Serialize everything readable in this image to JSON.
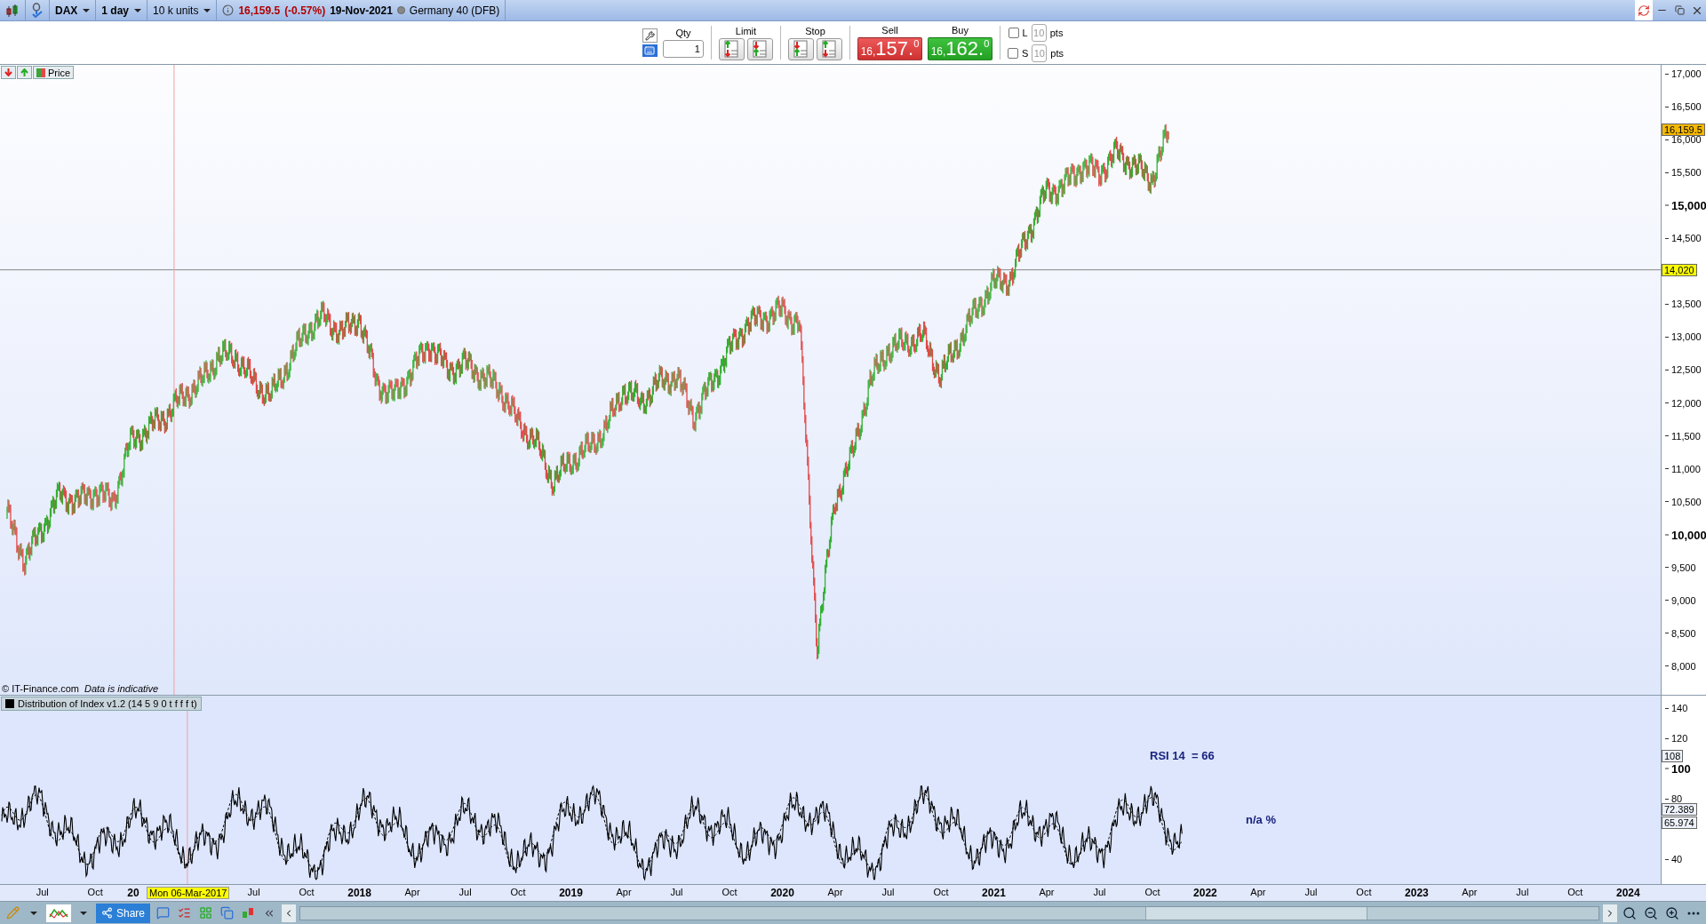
{
  "toolbar": {
    "symbol": "DAX",
    "interval": "1 day",
    "size": "10 k units",
    "price": "16,159.5",
    "change": "(-0.57%)",
    "date": "19-Nov-2021",
    "market": "Germany 40 (DFB)"
  },
  "ticket": {
    "qty_label": "Qty",
    "qty": "1",
    "limit_label": "Limit",
    "stop_label": "Stop",
    "sell": {
      "label": "Sell",
      "lead": "16,",
      "main": "157.",
      "tail": "0"
    },
    "buy": {
      "label": "Buy",
      "lead": "16,",
      "main": "162.",
      "tail": "0"
    },
    "stops": [
      {
        "label": "L",
        "value": "10",
        "unit": "pts",
        "checked": false
      },
      {
        "label": "S",
        "value": "10",
        "unit": "pts",
        "checked": false
      }
    ]
  },
  "price_panel": {
    "legend": "Price",
    "copyright": "© IT-Finance.com",
    "disclaimer": "Data is indicative",
    "last_price_tag": "16,159.5",
    "crosshair_price_tag": "14,020",
    "axis_labels": [
      {
        "label": "17,000",
        "kind": "minor"
      },
      {
        "label": "16,500",
        "kind": "minor"
      },
      {
        "label": "16,000",
        "kind": "minor"
      },
      {
        "label": "15,500",
        "kind": "minor"
      },
      {
        "label": "15,000",
        "kind": "major"
      },
      {
        "label": "14,500",
        "kind": "minor"
      },
      {
        "label": "13,500",
        "kind": "minor"
      },
      {
        "label": "13,000",
        "kind": "minor"
      },
      {
        "label": "12,500",
        "kind": "minor"
      },
      {
        "label": "12,000",
        "kind": "minor"
      },
      {
        "label": "11,500",
        "kind": "minor"
      },
      {
        "label": "11,000",
        "kind": "minor"
      },
      {
        "label": "10,500",
        "kind": "minor"
      },
      {
        "label": "10,000",
        "kind": "major"
      },
      {
        "label": "9,500",
        "kind": "minor"
      },
      {
        "label": "9,000",
        "kind": "minor"
      },
      {
        "label": "8,500",
        "kind": "minor"
      },
      {
        "label": "8,000",
        "kind": "minor"
      }
    ]
  },
  "indicator_panel": {
    "legend": "Distribution of Index v1.2 (14 5 9 0 t f f f t)",
    "rsi_text": "RSI 14  = 66",
    "pct_text": "n/a %",
    "axis_labels": [
      {
        "label": "140",
        "kind": "minor"
      },
      {
        "label": "120",
        "kind": "minor"
      },
      {
        "label": "100",
        "kind": "major"
      },
      {
        "label": "80",
        "kind": "minor"
      },
      {
        "label": "40",
        "kind": "minor"
      }
    ],
    "tags": [
      "108",
      "72.389",
      "65.974"
    ]
  },
  "time_axis": {
    "crosshair_date": "Mon 06-Mar-2017",
    "labels": [
      {
        "label": "Jul",
        "kind": "month"
      },
      {
        "label": "Oct",
        "kind": "month"
      },
      {
        "label": "20",
        "kind": "year"
      },
      {
        "label": "Jul",
        "kind": "month",
        "after_hidden": true
      },
      {
        "label": "Oct",
        "kind": "month"
      },
      {
        "label": "2018",
        "kind": "year"
      },
      {
        "label": "Apr",
        "kind": "month"
      },
      {
        "label": "Jul",
        "kind": "month"
      },
      {
        "label": "Oct",
        "kind": "month"
      },
      {
        "label": "2019",
        "kind": "year"
      },
      {
        "label": "Apr",
        "kind": "month"
      },
      {
        "label": "Jul",
        "kind": "month"
      },
      {
        "label": "Oct",
        "kind": "month"
      },
      {
        "label": "2020",
        "kind": "year"
      },
      {
        "label": "Apr",
        "kind": "month"
      },
      {
        "label": "Jul",
        "kind": "month"
      },
      {
        "label": "Oct",
        "kind": "month"
      },
      {
        "label": "2021",
        "kind": "year"
      },
      {
        "label": "Apr",
        "kind": "month"
      },
      {
        "label": "Jul",
        "kind": "month"
      },
      {
        "label": "Oct",
        "kind": "month"
      },
      {
        "label": "2022",
        "kind": "year"
      },
      {
        "label": "Apr",
        "kind": "month"
      },
      {
        "label": "Jul",
        "kind": "month"
      },
      {
        "label": "Oct",
        "kind": "month"
      },
      {
        "label": "2023",
        "kind": "year"
      },
      {
        "label": "Apr",
        "kind": "month"
      },
      {
        "label": "Jul",
        "kind": "month"
      },
      {
        "label": "Oct",
        "kind": "month"
      },
      {
        "label": "2024",
        "kind": "year"
      }
    ]
  },
  "bottom_toolbar": {
    "share": "Share"
  }
}
